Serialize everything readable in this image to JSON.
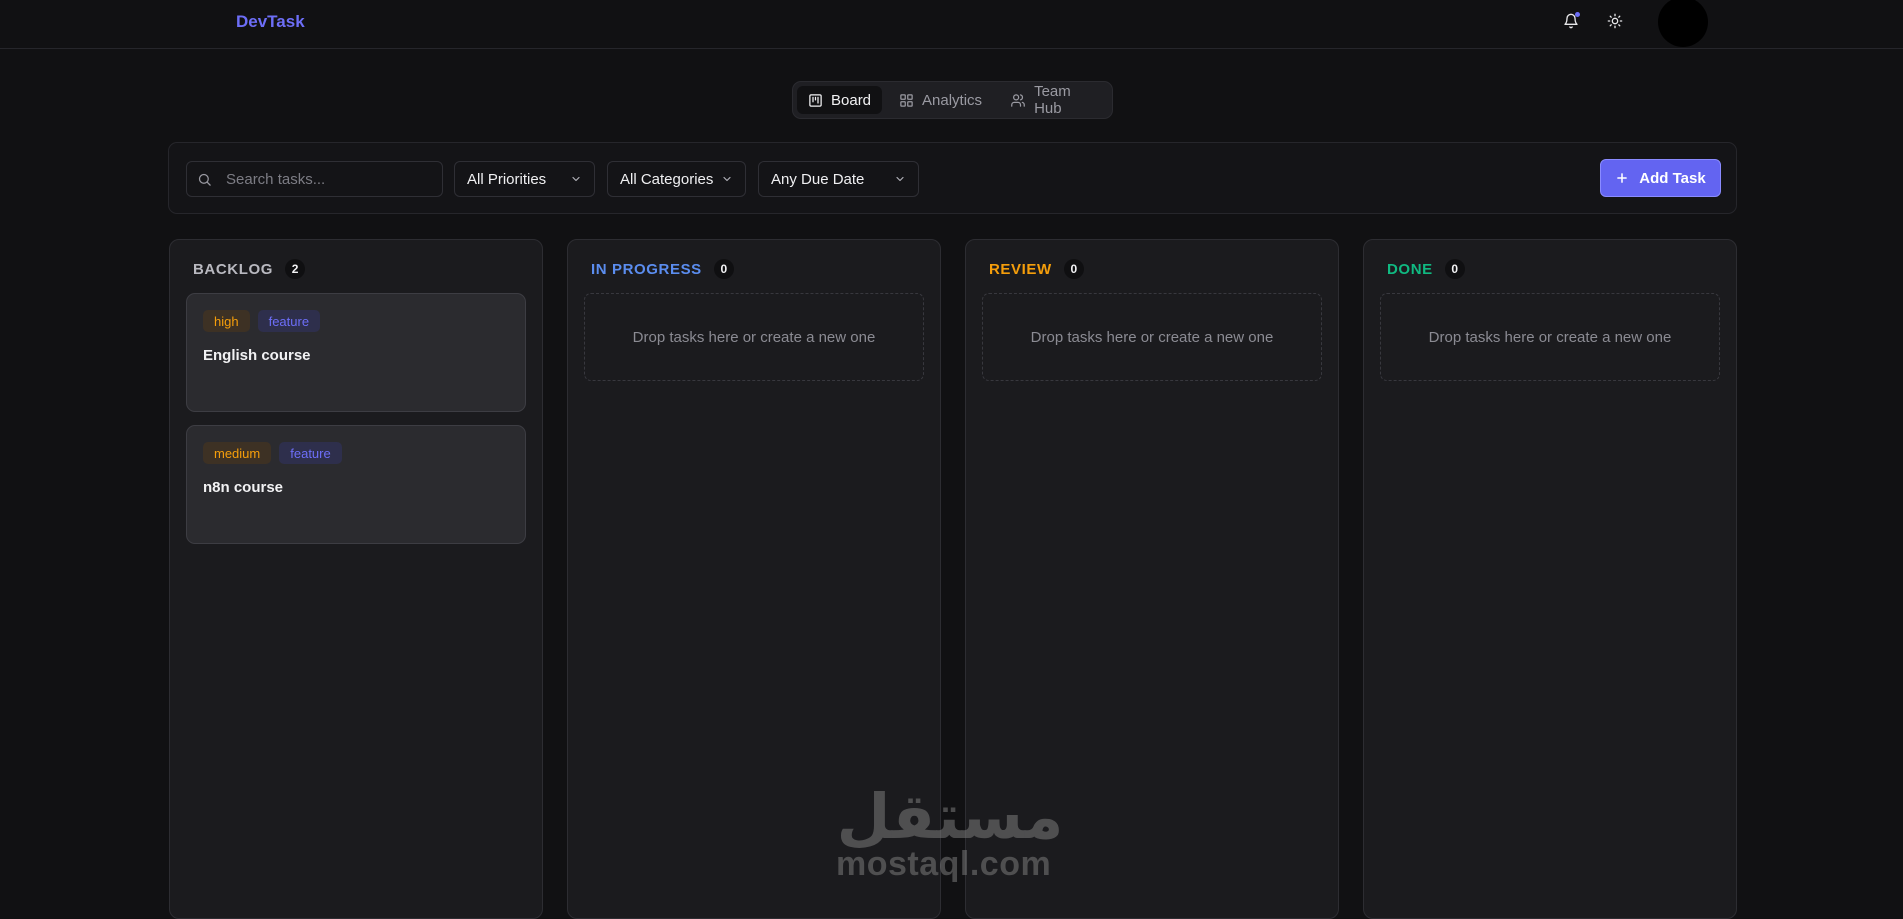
{
  "header": {
    "brand": "DevTask"
  },
  "tabs": [
    {
      "label": "Board",
      "icon": "board-icon",
      "active": true
    },
    {
      "label": "Analytics",
      "icon": "grid-icon",
      "active": false
    },
    {
      "label": "Team Hub",
      "icon": "users-icon",
      "active": false
    }
  ],
  "toolbar": {
    "search_placeholder": "Search tasks...",
    "search_value": "",
    "priority_filter": "All Priorities",
    "category_filter": "All Categories",
    "due_filter": "Any Due Date",
    "add_label": "Add Task"
  },
  "colors": {
    "accent": "#6364f1",
    "backlog": "#b9b9c0",
    "in_progress": "#5b8def",
    "review": "#f59e0b",
    "done": "#10b981",
    "high_tag_text": "#f59e0b",
    "feature_tag_text": "#6d6ef7"
  },
  "columns": [
    {
      "title": "BACKLOG",
      "count": "2",
      "cards": [
        {
          "priority": "high",
          "category": "feature",
          "title": "English course"
        },
        {
          "priority": "medium",
          "category": "feature",
          "title": "n8n course"
        }
      ]
    },
    {
      "title": "IN PROGRESS",
      "count": "0",
      "empty_text": "Drop tasks here or create a new one"
    },
    {
      "title": "REVIEW",
      "count": "0",
      "empty_text": "Drop tasks here or create a new one"
    },
    {
      "title": "DONE",
      "count": "0",
      "empty_text": "Drop tasks here or create a new one"
    }
  ],
  "watermark": {
    "arabic": "مستقل",
    "text": "mostaql.com"
  }
}
